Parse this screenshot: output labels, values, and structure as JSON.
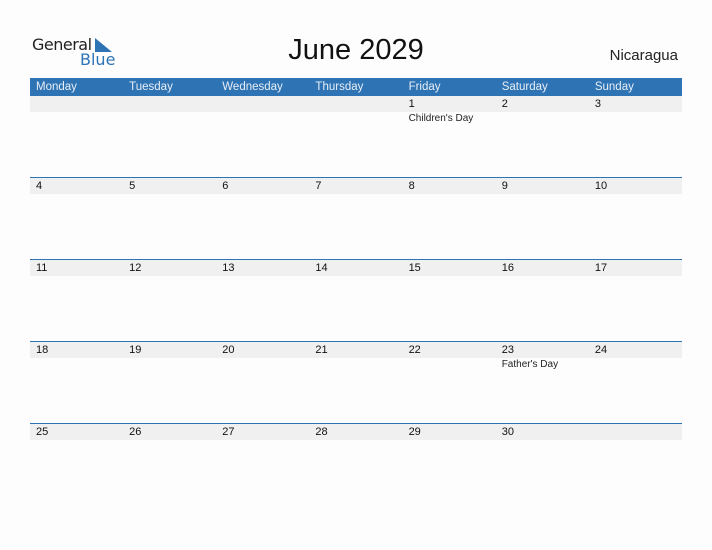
{
  "logo": {
    "general": "General",
    "blue": "Blue"
  },
  "title": "June 2029",
  "country": "Nicaragua",
  "colors": {
    "accent": "#2e74b5",
    "row_bg": "#f0f0f0"
  },
  "days": [
    "Monday",
    "Tuesday",
    "Wednesday",
    "Thursday",
    "Friday",
    "Saturday",
    "Sunday"
  ],
  "weeks": [
    {
      "days": [
        "",
        "",
        "",
        "",
        "1",
        "2",
        "3"
      ],
      "events": [
        "",
        "",
        "",
        "",
        "Children's Day",
        "",
        ""
      ]
    },
    {
      "days": [
        "4",
        "5",
        "6",
        "7",
        "8",
        "9",
        "10"
      ],
      "events": [
        "",
        "",
        "",
        "",
        "",
        "",
        ""
      ]
    },
    {
      "days": [
        "11",
        "12",
        "13",
        "14",
        "15",
        "16",
        "17"
      ],
      "events": [
        "",
        "",
        "",
        "",
        "",
        "",
        ""
      ]
    },
    {
      "days": [
        "18",
        "19",
        "20",
        "21",
        "22",
        "23",
        "24"
      ],
      "events": [
        "",
        "",
        "",
        "",
        "",
        "Father's Day",
        ""
      ]
    },
    {
      "days": [
        "25",
        "26",
        "27",
        "28",
        "29",
        "30",
        ""
      ],
      "events": [
        "",
        "",
        "",
        "",
        "",
        "",
        ""
      ]
    }
  ]
}
